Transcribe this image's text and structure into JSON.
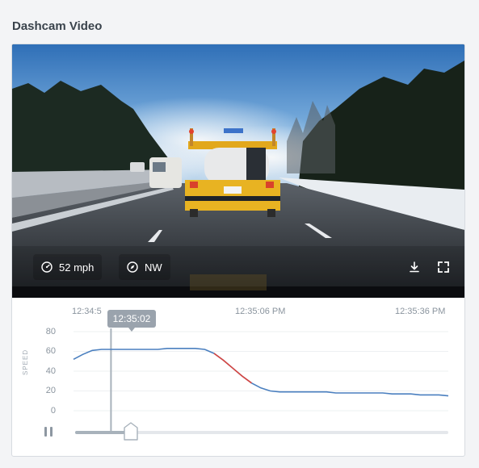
{
  "widget": {
    "title": "Dashcam Video"
  },
  "video": {
    "scene": "highway-dashcam-frame",
    "speed_readout": "52 mph",
    "heading_readout": "NW",
    "speed_icon": "speedometer-icon",
    "heading_icon": "compass-icon",
    "download_icon": "download-icon",
    "fullscreen_icon": "fullscreen-icon"
  },
  "timeline": {
    "time_labels": [
      "12:34:5",
      "12:35:06 PM",
      "12:35:36 PM"
    ],
    "current_time": "12:35:02",
    "y_axis_label": "SPEED",
    "y_ticks": [
      "80",
      "60",
      "40",
      "20",
      "0"
    ],
    "playback": {
      "state": "playing",
      "progress_fraction": 0.15
    },
    "colors": {
      "line": "#4a7fbf",
      "highlight": "#d9453f",
      "cursor": "#a8b2bb"
    }
  },
  "chart_data": {
    "type": "line",
    "ylabel": "SPEED",
    "ylim": [
      0,
      80
    ],
    "y_ticks": [
      0,
      20,
      40,
      60,
      80
    ],
    "grid": true,
    "series": [
      {
        "t": [
          0,
          1,
          2,
          3,
          4,
          5,
          6,
          7,
          8,
          9,
          10,
          11,
          12,
          13,
          14,
          15,
          16,
          17,
          18,
          19,
          20,
          21,
          22,
          23,
          24,
          25,
          26,
          27,
          28,
          29,
          30,
          31,
          32,
          33,
          34,
          35,
          36,
          37,
          38,
          39,
          40
        ],
        "values": [
          52,
          57,
          61,
          62,
          62,
          62,
          62,
          62,
          62,
          62,
          63,
          63,
          63,
          63,
          62,
          58,
          51,
          43,
          35,
          28,
          23,
          20,
          19,
          19,
          19,
          19,
          19,
          19,
          18,
          18,
          18,
          18,
          18,
          18,
          17,
          17,
          17,
          16,
          16,
          16,
          15
        ]
      }
    ],
    "highlight_range": [
      15,
      19
    ],
    "cursor_t": 4
  }
}
